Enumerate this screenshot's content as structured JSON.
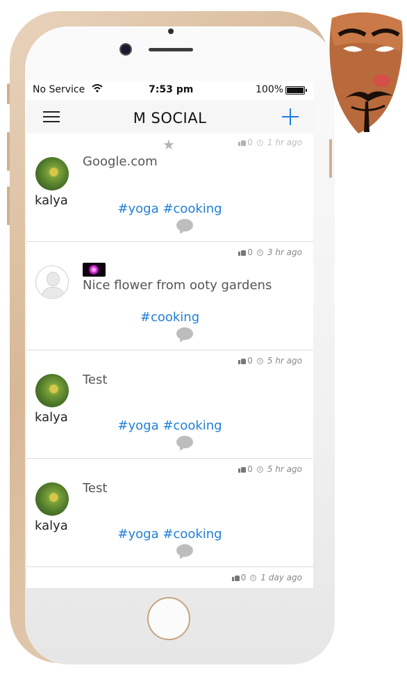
{
  "status_bar": {
    "carrier": "No Service",
    "time": "7:53 pm",
    "battery": "100%"
  },
  "navbar": {
    "title": "M SOCIAL"
  },
  "posts": [
    {
      "likes": "0",
      "time": "1 hr ago",
      "username": "kalya",
      "text": "Google.com",
      "tags": "#yoga #cooking"
    },
    {
      "likes": "0",
      "time": "3 hr ago",
      "username": "",
      "text": "Nice flower from ooty gardens",
      "tags": "#cooking"
    },
    {
      "likes": "0",
      "time": "5 hr ago",
      "username": "kalya",
      "text": "Test",
      "tags": "#yoga #cooking"
    },
    {
      "likes": "0",
      "time": "5 hr ago",
      "username": "kalya",
      "text": "Test",
      "tags": "#yoga #cooking"
    },
    {
      "likes": "0",
      "time": "1 day ago"
    }
  ],
  "colors": {
    "accent": "#1d7ce0",
    "tag": "#1f7fd8",
    "phone_frame": "#d7b896"
  }
}
